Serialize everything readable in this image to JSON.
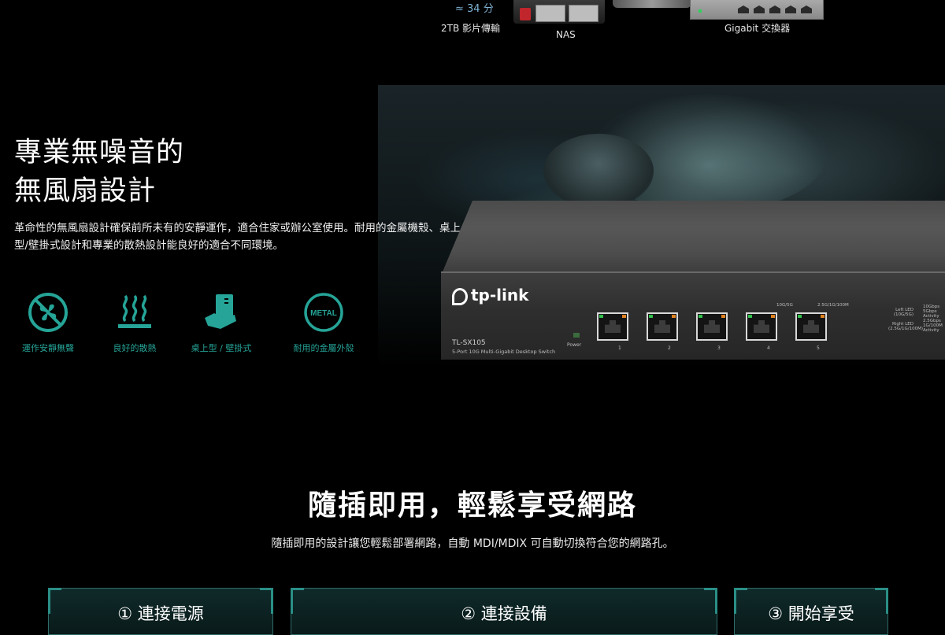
{
  "top_strip": {
    "time": "≈ 34 分",
    "transfer_label": "2TB 影片傳輸",
    "nas_label": "NAS",
    "switch_label": "Gigabit 交換器"
  },
  "hero": {
    "title_line1": "專業無噪音的",
    "title_line2": "無風扇設計",
    "description": "革命性的無風扇設計確保前所未有的安靜運作，適合住家或辦公室使用。耐用的金屬機殼、桌上型/壁掛式設計和專業的散熱設計能良好的適合不同環境。",
    "features": [
      {
        "icon": "fanless-icon",
        "label": "運作安靜無聲"
      },
      {
        "icon": "heat-dissipation-icon",
        "label": "良好的散熱"
      },
      {
        "icon": "desktop-wall-mount-icon",
        "label": "桌上型 / 壁掛式"
      },
      {
        "icon": "metal-casing-icon",
        "label": "耐用的金屬外殼",
        "badge": "METAL"
      }
    ],
    "accent_color": "#25a497"
  },
  "device": {
    "brand": "tp-link",
    "model": "TL-SX105",
    "model_desc": "5-Port 10G Multi-Gigabit Desktop Switch",
    "power_label": "Power",
    "speed_left": "10G/5G",
    "speed_right": "2.5G/1G/100M",
    "ports": [
      "1",
      "2",
      "3",
      "4",
      "5"
    ],
    "legend_left": [
      "Left LED",
      "(10G/5G)",
      "",
      "Right LED",
      "(2.5G/1G/100M)"
    ],
    "legend_right": [
      "10Gbps",
      "5Gbps",
      "Activity",
      "2.5Gbps",
      "1G/100M",
      "Activity"
    ]
  },
  "section2": {
    "title": "隨插即用，輕鬆享受網路",
    "description": "隨插即用的設計讓您輕鬆部署網路，自動 MDI/MDIX 可自動切換符合您的網路孔。",
    "steps": [
      "① 連接電源",
      "② 連接設備",
      "③ 開始享受"
    ]
  }
}
